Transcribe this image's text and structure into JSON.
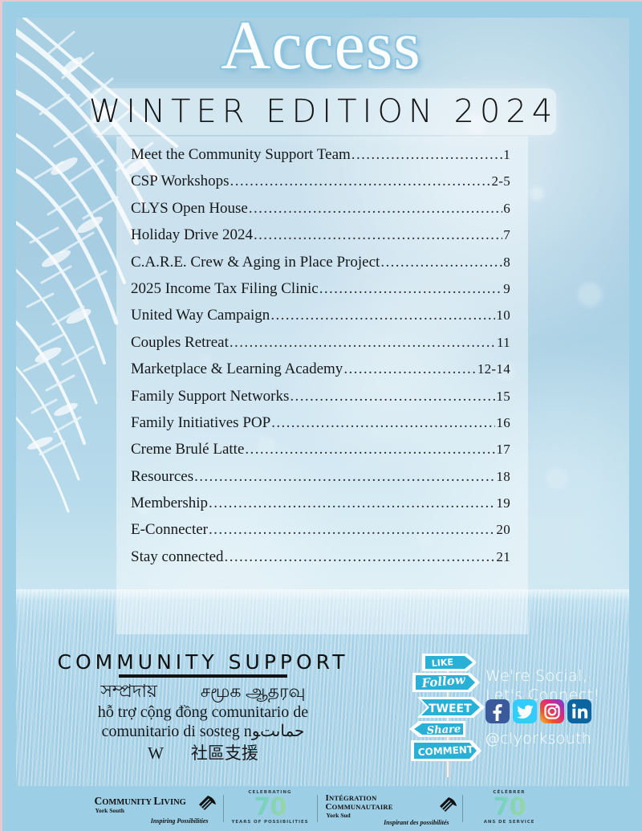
{
  "cover": {
    "magazine_title": "Access",
    "edition_banner": "WINTER EDITION 2024"
  },
  "toc": {
    "entries": [
      {
        "label": "Meet the Community Support Team",
        "page": "1"
      },
      {
        "label": "CSP Workshops ",
        "page": "2-5"
      },
      {
        "label": "CLYS Open House",
        "page": "6"
      },
      {
        "label": "Holiday Drive 2024",
        "page": "7"
      },
      {
        "label": "C.A.R.E. Crew & Aging in Place Project",
        "page": "8"
      },
      {
        "label": "2025 Income Tax Filing Clinic",
        "page": "9"
      },
      {
        "label": "United Way Campaign",
        "page": "10"
      },
      {
        "label": "Couples Retreat",
        "page": "11"
      },
      {
        "label": "Marketplace & Learning Academy ",
        "page": "12-14"
      },
      {
        "label": "Family Support Networks",
        "page": "15"
      },
      {
        "label": "Family Initiatives POP ",
        "page": "16"
      },
      {
        "label": "Creme Brulé Latte",
        "page": "17"
      },
      {
        "label": "Resources",
        "page": "18"
      },
      {
        "label": "Membership ",
        "page": "19"
      },
      {
        "label": "E-Connecter",
        "page": "20"
      },
      {
        "label": "Stay connected",
        "page": "21"
      }
    ],
    "dot_leader": "................................................................................................"
  },
  "community_support": {
    "heading": "COMMUNITY SUPPORT",
    "translations": {
      "bengali": "সম্প্রদায়",
      "tamil": "சமூக ஆதரவு",
      "line_vietnamese_spanish": "hỗ trợ cộng đồng comunitario de",
      "line_italian_arabic": "comunitario di sosteg nحماىتﻮ",
      "w_mark": "W",
      "chinese": "社區支援"
    }
  },
  "social": {
    "tagline_line1": "We're Social,",
    "tagline_line2": "Let's Connect!",
    "handle": "@clyorksouth",
    "signpost_labels": [
      "LIKE",
      "Follow",
      "TWEET",
      "Share",
      "COMMENT"
    ],
    "networks": [
      {
        "name": "facebook",
        "color": "#3b5a9b"
      },
      {
        "name": "twitter",
        "color": "#33ccff"
      },
      {
        "name": "instagram",
        "color": "#dd2a7b"
      },
      {
        "name": "linkedin",
        "color": "#0b65a1"
      }
    ],
    "signpost_color": "#29b0d6"
  },
  "footer": {
    "community_living": {
      "name_part1": "C",
      "name_part1_rest": "OMMUNITY ",
      "name_part2": "L",
      "name_part2_rest": "IVING",
      "region": "York South",
      "tagline": "Inspiring Possibilities"
    },
    "anniversary_en": {
      "top": "CELEBRATING",
      "number": "70",
      "bottom": "YEARS OF POSSIBILITIES"
    },
    "integration_communautaire": {
      "line1_cap": "I",
      "line1_rest": "NTÉGRATION",
      "line2_cap": "C",
      "line2_rest": "OMMUNAUTAIRE",
      "region": "York Sud",
      "tagline": "Inspirant des possibilités"
    },
    "anniversary_fr": {
      "top": "CÉLÉBRER",
      "number": "70",
      "bottom": "ANS DE SERVICE"
    }
  },
  "colors": {
    "page_frame": "#9ccfe6",
    "sky": "#a8cfe2",
    "panel": "rgba(255,255,255,0.42)",
    "title_outline": "#8cc6e2",
    "anniversary_gradient_start": "#5ec8c8",
    "anniversary_gradient_end": "#b9dc7e"
  }
}
